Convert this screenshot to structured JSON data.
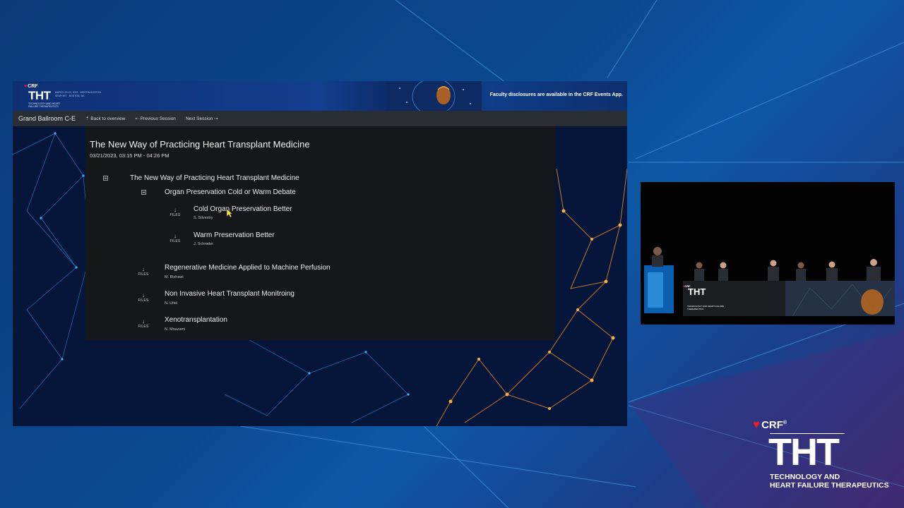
{
  "banner": {
    "crf_label": "CRF",
    "tht_label": "THT",
    "tht_subtitle": "TECHNOLOGY AND HEART FAILURE THERAPEUTICS",
    "event_dates": "MARCH 20-22, 2023 · WESTIN BOSTON SEAPORT · BOSTON, MA",
    "disclosure_text": "Faculty disclosures are available in the CRF Events App."
  },
  "nav": {
    "room": "Grand Ballroom C-E",
    "back_label": "Back to overview",
    "prev_label": "Previous Session",
    "next_label": "Next Session"
  },
  "session": {
    "title": "The New Way of Practicing Heart Transplant Medicine",
    "time": "03/21/2023, 03:15 PM - 04:26 PM"
  },
  "agenda": {
    "root_title": "The New Way of Practicing Heart Transplant Medicine",
    "group_title": "Organ Preservation Cold or Warm Debate",
    "files_label": "FILES",
    "talks": [
      {
        "title": "Cold Organ Preservation Better",
        "author": "S. Silvestry"
      },
      {
        "title": "Warm Preservation Better",
        "author": "J. Schroder"
      },
      {
        "title": "Regenerative Medicine Applied to Machine Perfusion",
        "author": "M. Bishawi"
      },
      {
        "title": "Non Invasive Heart Transplant Monitroing",
        "author": "N. Uriel"
      },
      {
        "title": "Xenotransplantation",
        "author": "N. Moazami"
      }
    ]
  },
  "stage": {
    "crf_label": "CRF",
    "tht_label": "THT",
    "tht_subtitle": "TECHNOLOGY AND HEART FAILURE THERAPEUTICS"
  },
  "footer": {
    "crf_label": "CRF",
    "tht_label": "THT",
    "subtitle_line1": "TECHNOLOGY AND",
    "subtitle_line2": "HEART FAILURE THERAPEUTICS"
  },
  "colors": {
    "background": "#0b4a92",
    "panel": "#16171b",
    "navbar": "#2a2d33",
    "crf_red": "#e4202e",
    "network_orange": "#e88a2a"
  }
}
